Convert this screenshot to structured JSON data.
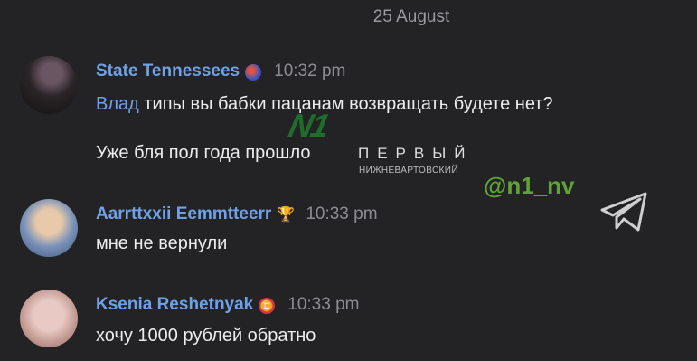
{
  "date_separator": "25 August",
  "messages": [
    {
      "sender": "State Tennessees",
      "time": "10:32 pm",
      "badge_icon": "globe-badge-icon",
      "lines": [
        {
          "mention": "Влад",
          "text": " типы вы бабки пацанам возвращать будете нет?"
        },
        {
          "mention": "",
          "text": "Уже бля пол года прошло"
        }
      ]
    },
    {
      "sender": "Aarrttxxii Eemmtteerr",
      "time": "10:33 pm",
      "badge_icon": "trophy-badge-icon",
      "lines": [
        {
          "mention": "",
          "text": "мне не вернули"
        }
      ]
    },
    {
      "sender": "Ksenia Reshetnyak",
      "time": "10:33 pm",
      "badge_icon": "gemini-badge-icon",
      "lines": [
        {
          "mention": "",
          "text": "хочу 1000 рублей обратно"
        }
      ]
    }
  ],
  "watermark": {
    "logo": "N1",
    "word": "ПЕРВЫЙ",
    "subtitle": "НИЖНЕВАРТОВСКИЙ",
    "handle": "@n1_nv",
    "icon": "telegram-icon"
  },
  "colors": {
    "background": "#232325",
    "username": "#6ea2e8",
    "handle_green": "#5fa334",
    "timestamp": "#8c8c92"
  }
}
